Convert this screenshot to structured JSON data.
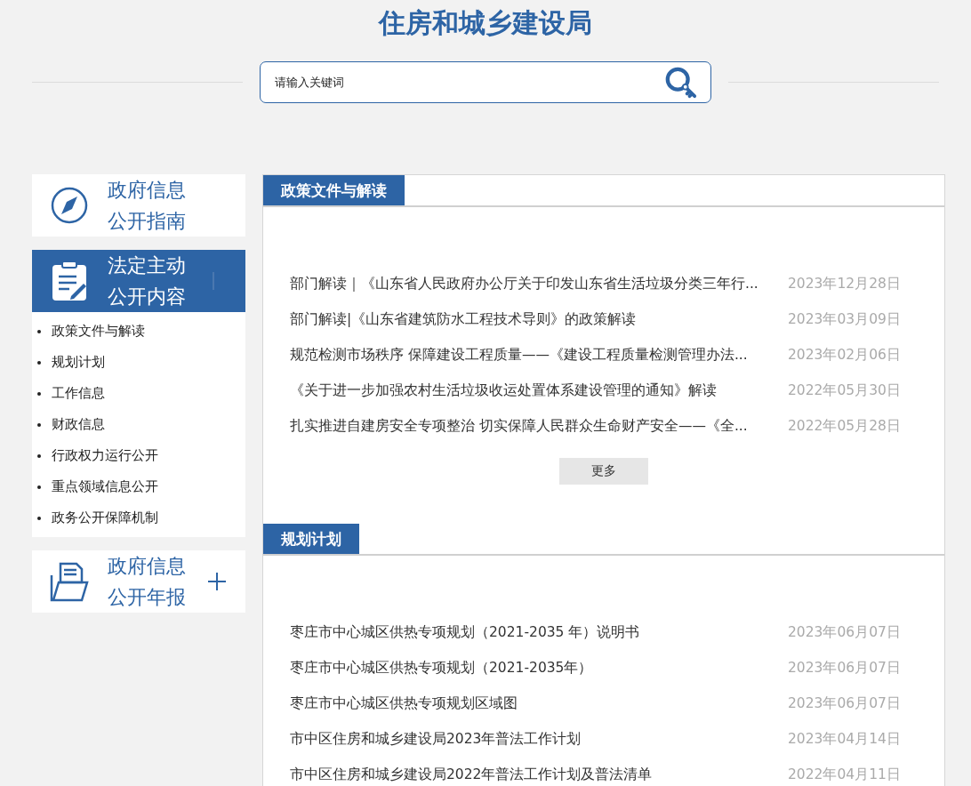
{
  "header": {
    "title": "住房和城乡建设局",
    "search": {
      "placeholder": "请输入关键词"
    }
  },
  "sidebar": {
    "panels": [
      {
        "kind": "compass",
        "label_lines": [
          "政府信息",
          "公开指南"
        ],
        "selected": false
      },
      {
        "kind": "clipboard",
        "label_lines": [
          "法定主动",
          "公开内容"
        ],
        "selected": true,
        "expanded": true,
        "children": [
          "政策文件与解读",
          "规划计划",
          "工作信息",
          "财政信息",
          "行政权力运行公开",
          "重点领域信息公开",
          "政务公开保障机制"
        ]
      },
      {
        "kind": "folder",
        "label_lines": [
          "政府信息",
          "公开年报"
        ],
        "selected": false,
        "expanded": false
      }
    ]
  },
  "sections": [
    {
      "title": "政策文件与解读",
      "more": "更多",
      "items": [
        {
          "title": "部门解读｜《山东省人民政府办公厅关于印发山东省生活垃圾分类三年行...",
          "date": "2023年12月28日"
        },
        {
          "title": "部门解读|《山东省建筑防水工程技术导则》的政策解读",
          "date": "2023年03月09日"
        },
        {
          "title": "规范检测市场秩序 保障建设工程质量——《建设工程质量检测管理办法...",
          "date": "2023年02月06日"
        },
        {
          "title": "《关于进一步加强农村生活垃圾收运处置体系建设管理的通知》解读",
          "date": "2022年05月30日"
        },
        {
          "title": "扎实推进自建房安全专项整治 切实保障人民群众生命财产安全——《全...",
          "date": "2022年05月28日"
        }
      ]
    },
    {
      "title": "规划计划",
      "items": [
        {
          "title": "枣庄市中心城区供热专项规划（2021-2035 年）说明书",
          "date": "2023年06月07日"
        },
        {
          "title": "枣庄市中心城区供热专项规划（2021-2035年）",
          "date": "2023年06月07日"
        },
        {
          "title": "枣庄市中心城区供热专项规划区域图",
          "date": "2023年06月07日"
        },
        {
          "title": "市中区住房和城乡建设局2023年普法工作计划",
          "date": "2023年04月14日"
        },
        {
          "title": "市中区住房和城乡建设局2022年普法工作计划及普法清单",
          "date": "2022年04月11日"
        }
      ]
    }
  ]
}
